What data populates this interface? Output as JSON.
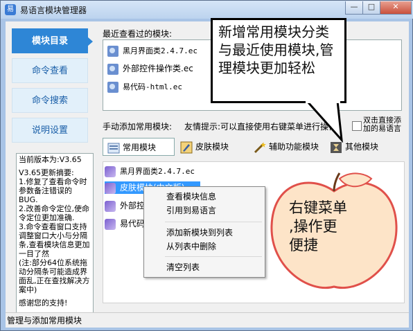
{
  "window": {
    "title": "易语言模块管理器",
    "title_icon": "app-icon",
    "minimize": "—",
    "maximize": "□",
    "close": "✕"
  },
  "sidebar": {
    "items": [
      {
        "label": "模块目录",
        "active": true
      },
      {
        "label": "命令查看",
        "active": false
      },
      {
        "label": "命令搜索",
        "active": false
      },
      {
        "label": "说明设置",
        "active": false
      }
    ]
  },
  "info": {
    "lines": [
      "当前版本为:V3.65",
      "",
      "V3.65更新摘要:",
      "1.修复了查看命令时参数备注错误的BUG.",
      "2.改善命令定位,使命令定位更加准确.",
      "3.命令查看窗口支持调整窗口大小与分隔条,查看模块信息更加一目了然",
      "(注:部分64位系统拖动分隔条可能造成界面乱,正在查找解决方案中)",
      "",
      "感谢您的支持!"
    ]
  },
  "recent": {
    "label": "最近查看过的模块:",
    "items": [
      {
        "name": "黑月界面类2.4.7.ec"
      },
      {
        "name": "外部控件操作类.ec"
      },
      {
        "name": "易代码-html.ec"
      }
    ]
  },
  "manual_add": {
    "label": "手动添加常用模块:",
    "tip": "友情提示:可以直接使用右键菜单进行操作",
    "checkbox_label_1": "双击直接添",
    "checkbox_label_2": "加的易语言"
  },
  "tabs": [
    {
      "label": "常用模块",
      "active": true
    },
    {
      "label": "皮肤模块",
      "active": false
    },
    {
      "label": "辅助功能模块",
      "active": false
    },
    {
      "label": "其他模块",
      "active": false
    }
  ],
  "module_list": {
    "items": [
      {
        "name": "黑月界面类2.4.7.ec"
      },
      {
        "name": "皮肤模块(中文版)",
        "selected": true
      },
      {
        "name": "外部控"
      },
      {
        "name": "易代码"
      }
    ]
  },
  "context_menu": {
    "items": [
      "查看模块信息",
      "引用到易语言",
      "添加新模块到列表",
      "从列表中删除",
      "清空列表"
    ]
  },
  "status": {
    "text": "管理与添加常用模块"
  },
  "callout_top": {
    "text": "新增常用模块分类与最近使用模块,管理模块更加轻松"
  },
  "callout_apple": {
    "lines": [
      "右键菜单",
      ",操作更",
      "便捷"
    ]
  },
  "colors": {
    "accent": "#2e86d6",
    "selection": "#3399ff",
    "apple_fill": "#fde4c8",
    "apple_border": "#e0504a"
  }
}
